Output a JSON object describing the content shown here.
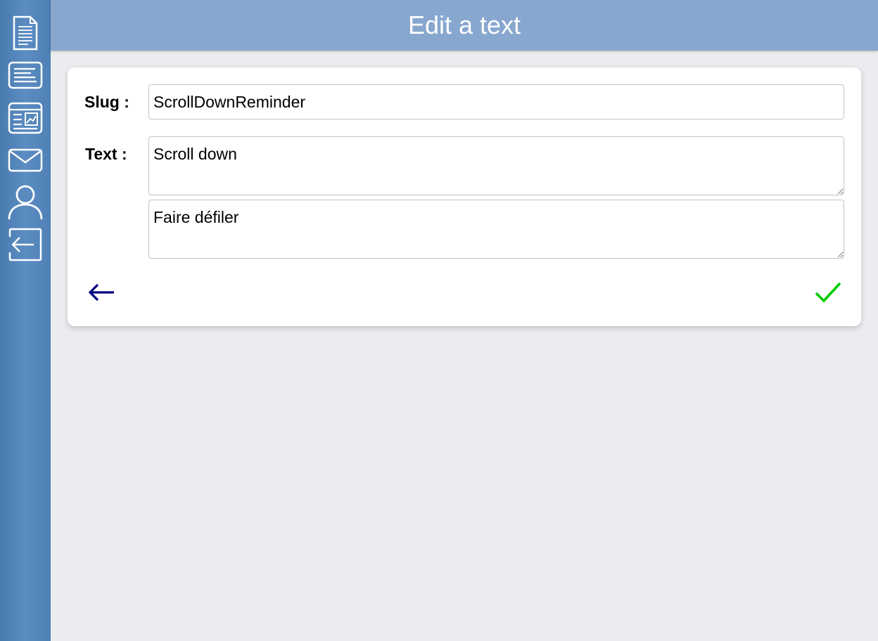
{
  "sidebar": {
    "items": [
      {
        "icon": "document-icon"
      },
      {
        "icon": "text-lines-icon"
      },
      {
        "icon": "article-icon"
      },
      {
        "icon": "mail-icon"
      },
      {
        "icon": "user-icon"
      },
      {
        "icon": "logout-icon"
      }
    ]
  },
  "header": {
    "title": "Edit a text"
  },
  "form": {
    "slug_label": "Slug :",
    "slug_value": "ScrollDownReminder",
    "text_label": "Text :",
    "text_values": [
      "Scroll down",
      "Faire défiler"
    ],
    "back_icon": "arrow-left-icon",
    "confirm_icon": "checkmark-icon"
  },
  "colors": {
    "sidebar": "#5b8cc2",
    "header": "#87a7ce",
    "background": "#eaecef",
    "back_arrow": "#000080",
    "confirm_check": "#00cc00"
  }
}
